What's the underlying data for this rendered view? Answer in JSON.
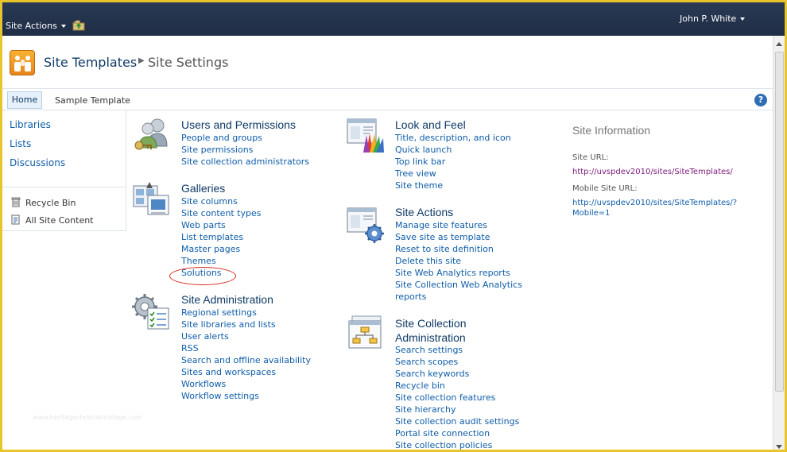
{
  "ribbon": {
    "site_actions_label": "Site Actions",
    "user_name": "John P. White"
  },
  "title": {
    "site_name": "Site Templates",
    "page_name": "Site Settings"
  },
  "top_nav": {
    "tabs": [
      {
        "label": "Home",
        "selected": true
      },
      {
        "label": "Sample Template",
        "selected": false
      }
    ],
    "help_label": "?"
  },
  "quick_launch": {
    "links": [
      "Libraries",
      "Lists",
      "Discussions"
    ],
    "utility": [
      {
        "label": "Recycle Bin",
        "icon": "recycle-bin-icon"
      },
      {
        "label": "All Site Content",
        "icon": "all-site-content-icon"
      }
    ]
  },
  "sections": {
    "users": {
      "title": "Users and Permissions",
      "icon": "users-permissions-icon",
      "links": [
        "People and groups",
        "Site permissions",
        "Site collection administrators"
      ]
    },
    "galleries": {
      "title": "Galleries",
      "icon": "galleries-icon",
      "links": [
        "Site columns",
        "Site content types",
        "Web parts",
        "List templates",
        "Master pages",
        "Themes",
        "Solutions"
      ]
    },
    "site_admin": {
      "title": "Site Administration",
      "icon": "site-administration-icon",
      "links": [
        "Regional settings",
        "Site libraries and lists",
        "User alerts",
        "RSS",
        "Search and offline availability",
        "Sites and workspaces",
        "Workflows",
        "Workflow settings"
      ]
    },
    "look": {
      "title": "Look and Feel",
      "icon": "look-and-feel-icon",
      "links": [
        "Title, description, and icon",
        "Quick launch",
        "Top link bar",
        "Tree view",
        "Site theme"
      ]
    },
    "site_actions": {
      "title": "Site Actions",
      "icon": "site-actions-icon",
      "links": [
        "Manage site features",
        "Save site as template",
        "Reset to site definition",
        "Delete this site",
        "Site Web Analytics reports",
        "Site Collection Web Analytics",
        "reports"
      ]
    },
    "site_collection": {
      "title_line1": "Site Collection",
      "title_line2": "Administration",
      "icon": "site-collection-icon",
      "links": [
        "Search settings",
        "Search scopes",
        "Search keywords",
        "Recycle bin",
        "Site collection features",
        "Site hierarchy",
        "Site collection audit settings",
        "Portal site connection",
        "Site collection policies"
      ]
    }
  },
  "site_info": {
    "title": "Site Information",
    "url_label": "Site URL:",
    "url": "http://uvspdev2010/sites/SiteTemplates/",
    "mobile_label": "Mobile Site URL:",
    "mobile_url": "http://uvspdev2010/sites/SiteTemplates/?Mobile=1"
  },
  "watermark": "www.heritagechristiancollege.com",
  "colors": {
    "ribbon": "#1f2d45",
    "link": "#0f5da8",
    "heading": "#0f3a66",
    "visited_link": "#7b1a7b",
    "highlight_circle": "#d7261e",
    "frame": "#e8c52a"
  }
}
